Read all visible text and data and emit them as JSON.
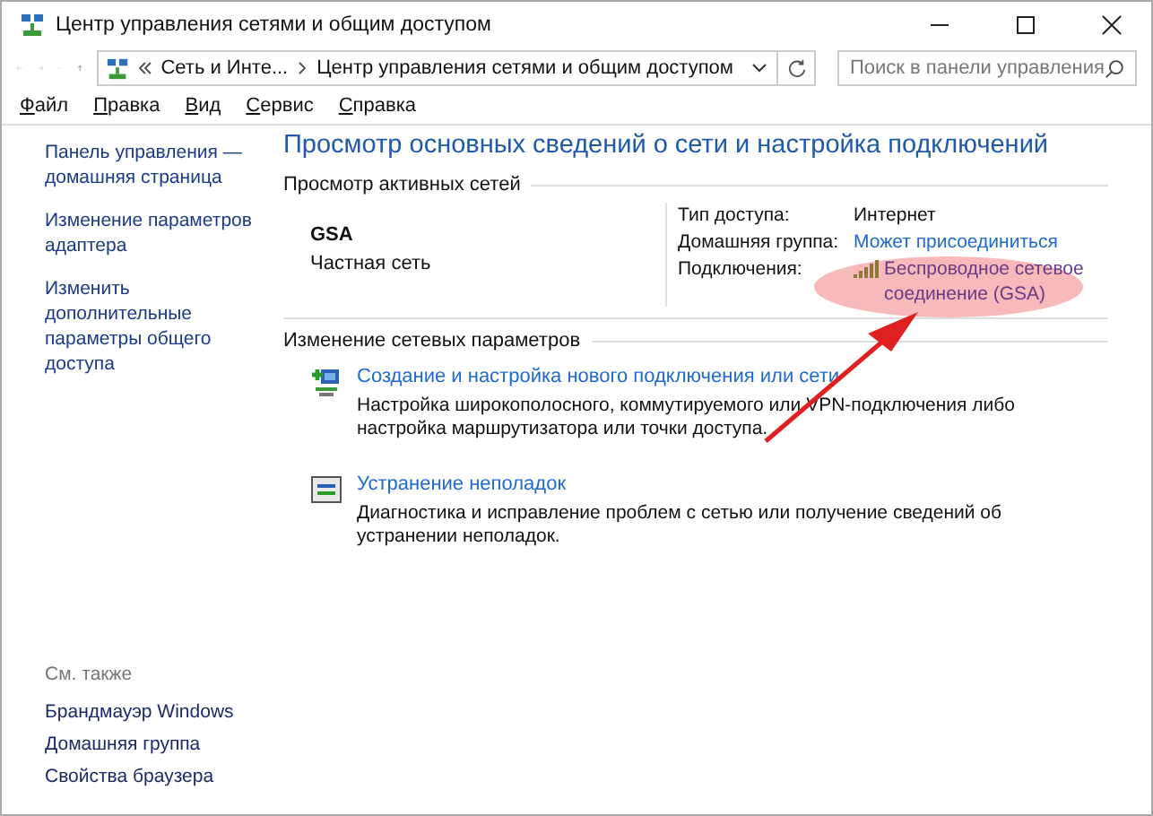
{
  "window": {
    "title": "Центр управления сетями и общим доступом"
  },
  "address_bar": {
    "breadcrumb": [
      {
        "label": "Сеть и Инте..."
      },
      {
        "label": "Центр управления сетями и общим доступом"
      }
    ]
  },
  "search": {
    "placeholder": "Поиск в панели управления"
  },
  "menu": [
    "Файл",
    "Правка",
    "Вид",
    "Сервис",
    "Справка"
  ],
  "sidebar": {
    "links": [
      "Панель управления — домашняя страница",
      "Изменение параметров адаптера",
      "Изменить дополнительные параметры общего доступа"
    ],
    "see_also_heading": "См. также",
    "see_also": [
      "Брандмауэр Windows",
      "Домашняя группа",
      "Свойства браузера"
    ]
  },
  "main": {
    "heading": "Просмотр основных сведений о сети и настройка подключений",
    "active_networks": {
      "heading": "Просмотр активных сетей",
      "network": {
        "name": "GSA",
        "type": "Частная сеть"
      },
      "properties": [
        {
          "label": "Тип доступа:",
          "value": "Интернет",
          "kind": "text"
        },
        {
          "label": "Домашняя группа:",
          "value": "Может присоединиться",
          "kind": "link"
        },
        {
          "label": "Подключения:",
          "value": "Беспроводное сетевое соединение (GSA)",
          "kind": "connection"
        }
      ]
    },
    "change_settings": {
      "heading": "Изменение сетевых параметров",
      "tasks": [
        {
          "title": "Создание и настройка нового подключения или сети",
          "description": "Настройка широкополосного, коммутируемого или VPN-подключения либо настройка маршрутизатора или точки доступа.",
          "kind": "new-connection"
        },
        {
          "title": "Устранение неполадок",
          "description": "Диагностика и исправление проблем с сетью или получение сведений об устранении неполадок.",
          "kind": "troubleshoot"
        }
      ]
    }
  }
}
